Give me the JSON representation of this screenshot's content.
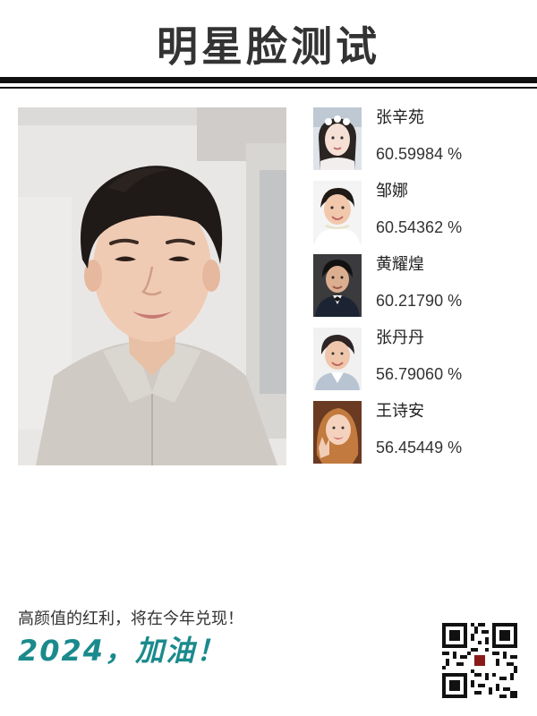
{
  "header": {
    "title": "明星脸测试"
  },
  "user_photo": {
    "icon": "user-selfie-photo"
  },
  "matches": [
    {
      "name": "张辛苑",
      "score": "60.59984 %",
      "icon": "celebrity-portrait"
    },
    {
      "name": "邹娜",
      "score": "60.54362 %",
      "icon": "celebrity-portrait"
    },
    {
      "name": "黄耀煌",
      "score": "60.21790 %",
      "icon": "celebrity-portrait"
    },
    {
      "name": "张丹丹",
      "score": "56.79060 %",
      "icon": "celebrity-portrait"
    },
    {
      "name": "王诗安",
      "score": "56.45449 %",
      "icon": "celebrity-portrait"
    }
  ],
  "footer": {
    "slogan": "高颜值的红利，将在今年兑现！",
    "cheer": "2024，加油！",
    "qr_icon": "qr-code"
  },
  "colors": {
    "accent": "#1b8a8c",
    "rule": "#111111"
  }
}
